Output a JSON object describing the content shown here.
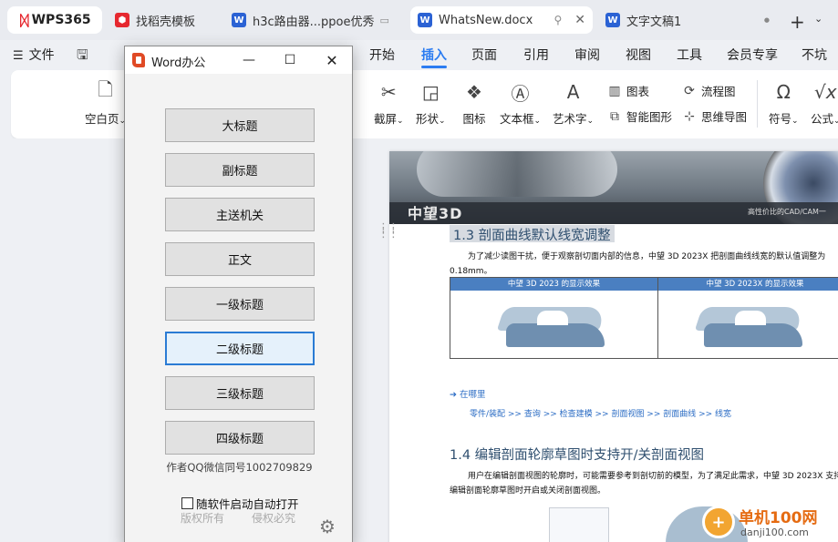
{
  "tabs": {
    "logo": "WPS365",
    "items": [
      {
        "label": "找稻壳模板",
        "icon_color": "#e6282f",
        "icon_glyph": "⬢"
      },
      {
        "label": "h3c路由器...ppoe优秀",
        "icon_color": "#2b62d4",
        "icon_glyph": "W"
      },
      {
        "label": "WhatsNew.docx",
        "icon_color": "#2b62d4",
        "icon_glyph": "W"
      },
      {
        "label": "文字文稿1",
        "icon_color": "#2b62d4",
        "icon_glyph": "W"
      }
    ],
    "close_glyph": "✕",
    "new_tab": "+"
  },
  "menubar": {
    "file": "文件",
    "items": [
      "开始",
      "插入",
      "页面",
      "引用",
      "审阅",
      "视图",
      "工具",
      "会员专享",
      "不坑"
    ],
    "active": "插入"
  },
  "ribbon": {
    "blank_page": "空白页",
    "screenshot": "截屏",
    "shape": "形状",
    "icon": "图标",
    "textbox": "文本框",
    "wordart": "艺术字",
    "chart": "图表",
    "smart_graphic": "智能图形",
    "flowchart": "流程图",
    "mindmap": "思维导图",
    "symbol": "符号",
    "formula": "公式"
  },
  "document": {
    "banner_logo": "中望3D",
    "banner_tagline": "高性价比的CAD/CAM一",
    "heading_1_3": "1.3 剖面曲线默认线宽调整",
    "para_1_3": "为了减少读图干扰，便于观察剖切面内部的信息，中望 3D 2023X 把剖面曲线线宽的默认值调整为 0.18mm。",
    "table_col1": "中望 3D 2023 的显示效果",
    "table_col2": "中望 3D 2023X 的显示效果",
    "location_label": "➔ 在哪里",
    "location_path": "零件/装配 >> 查询 >> 检查建模 >> 剖面视图 >> 剖面曲线 >> 线宽",
    "heading_1_4": "1.4 编辑剖面轮廓草图时支持开/关剖面视图",
    "para_1_4": "用户在编辑剖面视图的轮廓时，可能需要参考到剖切前的模型，为了满足此需求，中望 3D 2023X 支持在编辑剖面轮廓草图时开启或关闭剖面视图。"
  },
  "watermark": {
    "name": "单机100网",
    "url": "danji100.com"
  },
  "dialog": {
    "title": "Word办公",
    "buttons": [
      "大标题",
      "副标题",
      "主送机关",
      "正文",
      "一级标题",
      "二级标题",
      "三级标题",
      "四级标题"
    ],
    "focused_button": "二级标题",
    "author": "作者QQ微信同号1002709829",
    "autostart_label": "随软件启动自动打开",
    "autostart_checked": false,
    "rights_left": "版权所有",
    "rights_right": "侵权必究"
  }
}
